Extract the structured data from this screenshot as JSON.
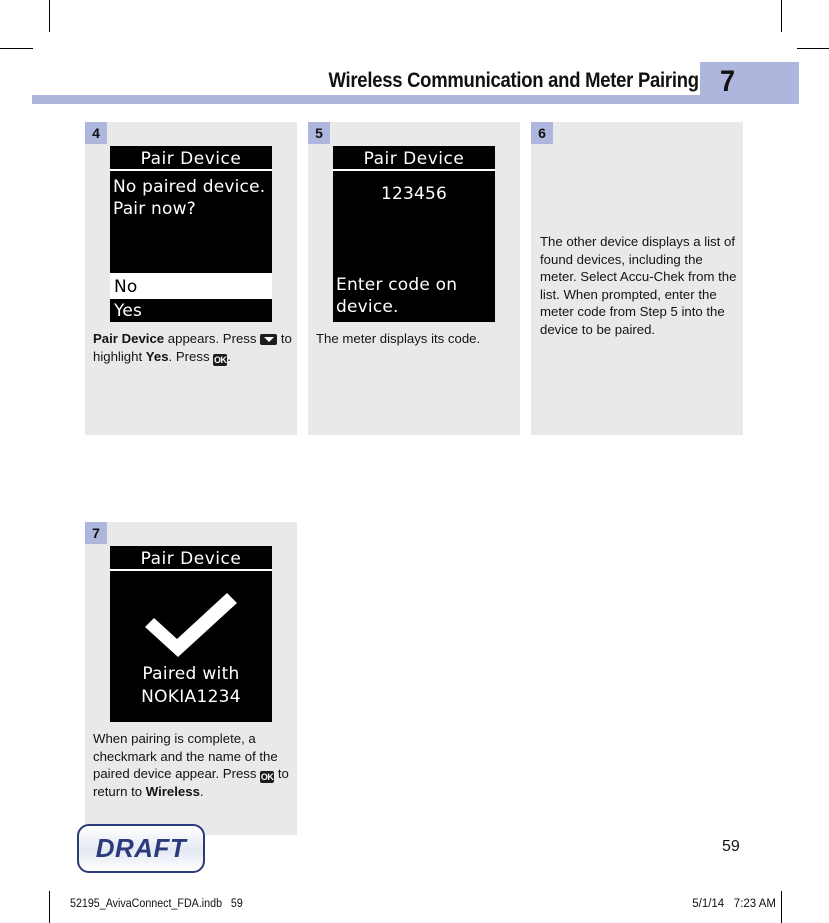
{
  "crop_marks": true,
  "header": {
    "title": "Wireless Communication and Meter Pairing",
    "chapter_number": "7",
    "accent_color": "#aeb6dd"
  },
  "panels": [
    {
      "step": "4",
      "screen": {
        "title": "Pair Device",
        "body_lines": [
          "No paired device.",
          "Pair now?"
        ],
        "options": [
          {
            "label": "No",
            "selected": true
          },
          {
            "label": "Yes",
            "selected": false
          }
        ]
      },
      "caption_parts": [
        {
          "text": "Pair Device",
          "bold": true
        },
        {
          "text": " appears. Press ",
          "bold": false
        },
        {
          "icon": "down-arrow-key-icon"
        },
        {
          "text": " to highlight ",
          "bold": false
        },
        {
          "text": "Yes",
          "bold": true
        },
        {
          "text": ". Press ",
          "bold": false
        },
        {
          "icon": "ok-key-icon"
        },
        {
          "text": ".",
          "bold": false
        }
      ]
    },
    {
      "step": "5",
      "screen": {
        "title": "Pair Device",
        "code": "123456",
        "body_lines": [
          "Enter code on",
          "device."
        ]
      },
      "caption_parts": [
        {
          "text": "The meter displays its code.",
          "bold": false
        }
      ]
    },
    {
      "step": "6",
      "text_only": true,
      "caption_parts": [
        {
          "text": "The other device displays a list of found devices, including the meter. Select Accu-Chek from the list. When prompted, enter the meter code from Step 5 into the device to be paired.",
          "bold": false
        }
      ]
    },
    {
      "step": "7",
      "screen": {
        "title": "Pair Device",
        "icon": "checkmark-icon",
        "caption_lines": [
          "Paired with",
          "NOKIA1234"
        ]
      },
      "caption_parts": [
        {
          "text": "When pairing is complete, a checkmark and the name of the paired device appear. Press ",
          "bold": false
        },
        {
          "icon": "ok-key-icon"
        },
        {
          "text": " to return to ",
          "bold": false
        },
        {
          "text": "Wireless",
          "bold": true
        },
        {
          "text": ".",
          "bold": false
        }
      ]
    }
  ],
  "draft_stamp": {
    "label": "DRAFT",
    "color": "#2b3a7a"
  },
  "page_number": "59",
  "footer": {
    "left": "52195_AvivaConnect_FDA.indb   59",
    "right": "5/1/14   7:23 AM"
  },
  "key_icons": {
    "down_arrow": "down-arrow-key-icon",
    "ok": "OK"
  }
}
